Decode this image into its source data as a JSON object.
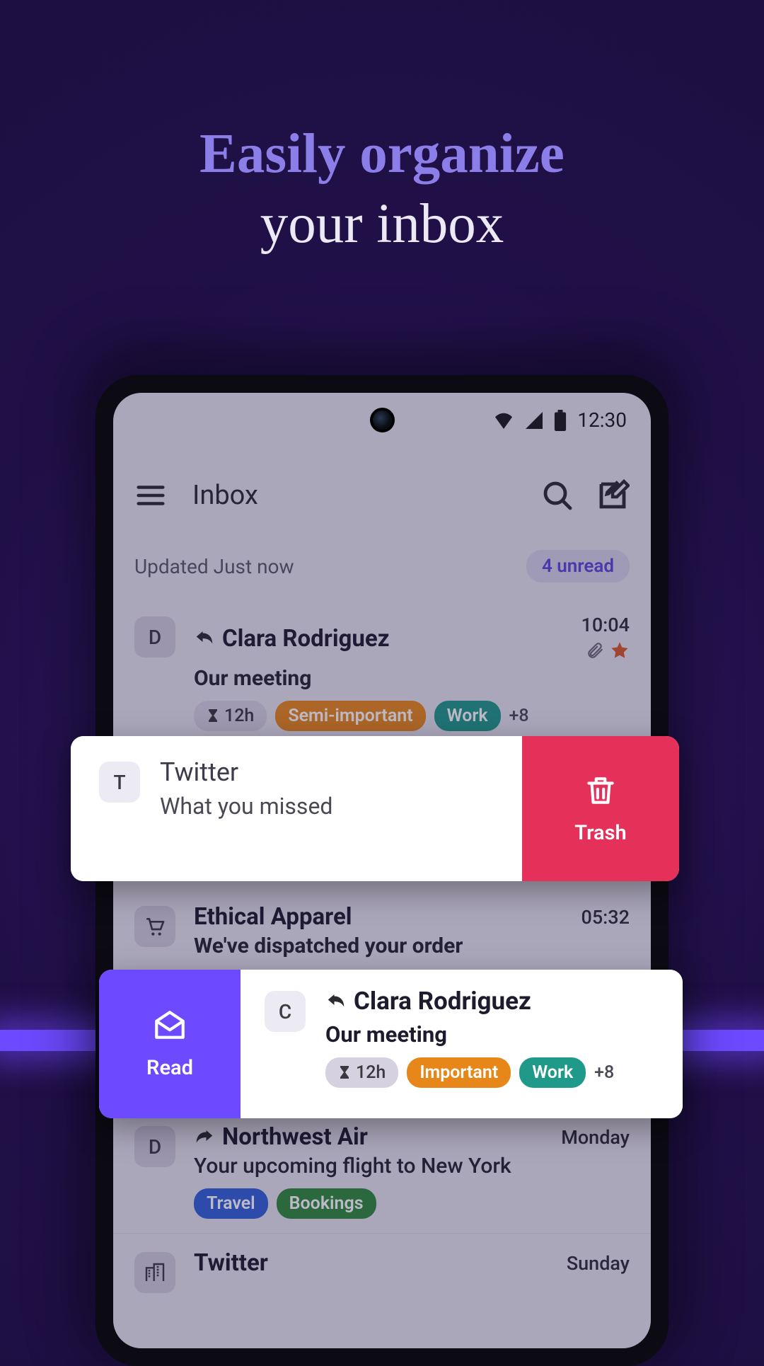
{
  "headline": {
    "line1": "Easily organize",
    "line2": "your inbox"
  },
  "status": {
    "time": "12:30"
  },
  "appbar": {
    "title": "Inbox"
  },
  "subhead": {
    "updated": "Updated Just now",
    "unread": "4 unread"
  },
  "emails": [
    {
      "avatar": "D",
      "sender": "Clara Rodriguez",
      "reply_indicator": true,
      "subject": "Our meeting",
      "time": "10:04",
      "attachment": true,
      "starred": true,
      "snooze": "12h",
      "label1": "Semi-important",
      "label2": "Work",
      "more": "+8"
    },
    {
      "avatar": "cart",
      "sender": "Ethical Apparel",
      "subject": "We've dispatched your order",
      "time": "05:32"
    },
    {
      "avatar": "D",
      "sender": "Northwest Air",
      "forward_indicator": true,
      "subject": "Your upcoming flight to New York",
      "time": "Monday",
      "label1": "Travel",
      "label2": "Bookings"
    },
    {
      "avatar": "building",
      "sender": "Twitter",
      "time": "Sunday"
    }
  ],
  "swipe_trash": {
    "avatar": "T",
    "sender": "Twitter",
    "subject": "What you missed",
    "action": "Trash"
  },
  "swipe_read": {
    "avatar": "C",
    "sender": "Clara Rodriguez",
    "subject": "Our meeting",
    "snooze": "12h",
    "label1": "Important",
    "label2": "Work",
    "more": "+8",
    "action": "Read"
  }
}
